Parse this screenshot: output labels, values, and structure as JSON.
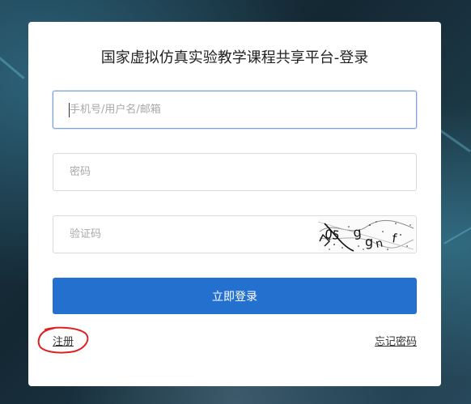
{
  "login": {
    "title": "国家虚拟仿真实验教学课程共享平台-登录",
    "username_placeholder": "手机号/用户名/邮箱",
    "password_placeholder": "密码",
    "captcha_placeholder": "验证码",
    "captcha_text": "Q5 g g n f",
    "submit_label": "立即登录",
    "register_label": "注册",
    "forgot_label": "忘记密码"
  },
  "colors": {
    "primary_button": "#2470cf",
    "focus_border": "#7fa4e0",
    "annotation": "#e02020"
  }
}
